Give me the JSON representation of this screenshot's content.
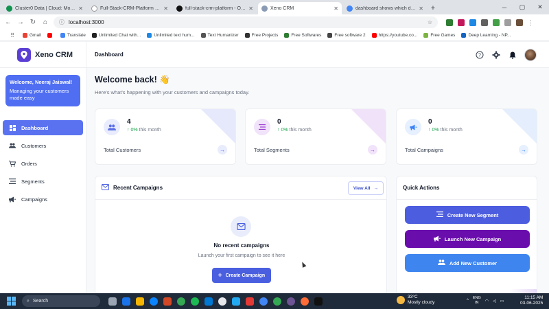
{
  "browser": {
    "tabs": [
      {
        "title": "Cluster0 Data | Cloud: MongoDB",
        "color": "#12924f",
        "active": false
      },
      {
        "title": "Full-Stack-CRM-Platform - We...",
        "color": "#ffffff",
        "active": false
      },
      {
        "title": "full-stack-crm-platform - Over...",
        "color": "#111111",
        "active": false
      },
      {
        "title": "Xeno CRM",
        "color": "#8a9bb3",
        "active": true
      },
      {
        "title": "dashboard shows which data a...",
        "color": "#4285f4",
        "active": false
      }
    ],
    "new_tab": "+",
    "url": "localhost:3000",
    "bookmarks": [
      {
        "label": "Gmail",
        "color": "#ea4335"
      },
      {
        "label": "",
        "color": "#ff0000"
      },
      {
        "label": "Translate",
        "color": "#4285f4"
      },
      {
        "label": "Unlimited Chat with...",
        "color": "#222222"
      },
      {
        "label": "Unlimited text hum...",
        "color": "#1e88e5"
      },
      {
        "label": "Text Humanizer",
        "color": "#555555"
      },
      {
        "label": "Free Projects",
        "color": "#333333"
      },
      {
        "label": "Free Softwares",
        "color": "#2e7d32"
      },
      {
        "label": "Free software 2",
        "color": "#444444"
      },
      {
        "label": "https://youtube.co...",
        "color": "#ff0000"
      },
      {
        "label": "Free Games",
        "color": "#7cb342"
      },
      {
        "label": "Deep Learning - NP...",
        "color": "#1565c0"
      }
    ]
  },
  "app": {
    "brand": "Xeno CRM",
    "welcome_card": {
      "title": "Welcome, Neeraj Jaiswal!",
      "subtitle": "Managing your customers made easy"
    },
    "menu": [
      {
        "label": "Dashboard",
        "icon": "grid-icon",
        "active": true
      },
      {
        "label": "Customers",
        "icon": "people-icon",
        "active": false
      },
      {
        "label": "Orders",
        "icon": "cart-icon",
        "active": false
      },
      {
        "label": "Segments",
        "icon": "list-icon",
        "active": false
      },
      {
        "label": "Campaigns",
        "icon": "megaphone-icon",
        "active": false
      }
    ],
    "page_title": "Dashboard",
    "greeting": "Welcome back! 👋",
    "greeting_sub": "Here's what's happening with your customers and campaigns today.",
    "stats": [
      {
        "value": "4",
        "trend": "0%",
        "trend_suffix": "this month",
        "label": "Total Customers",
        "accent": "#5b6ee6",
        "tint": "#e8ecfc",
        "corner": "#e6e9fb"
      },
      {
        "value": "0",
        "trend": "0%",
        "trend_suffix": "this month",
        "label": "Total Segments",
        "accent": "#9b3fd1",
        "tint": "#f1e3fa",
        "corner": "#f0e2f9"
      },
      {
        "value": "0",
        "trend": "0%",
        "trend_suffix": "this month",
        "label": "Total Campaigns",
        "accent": "#3b82f6",
        "tint": "#e6f0fe",
        "corner": "#e4eefc"
      }
    ],
    "recent_campaigns": {
      "title": "Recent Campaigns",
      "view_all": "View All",
      "empty_title": "No recent campaigns",
      "empty_sub": "Launch your first campaign to see it here",
      "create_button": "Create Campaign"
    },
    "quick_actions": {
      "title": "Quick Actions",
      "buttons": [
        {
          "label": "Create New Segment",
          "color": "#4c5ddf"
        },
        {
          "label": "Launch New Campaign",
          "color": "#6a0dad"
        },
        {
          "label": "Add New Customer",
          "color": "#3f85f0"
        }
      ]
    }
  },
  "taskbar": {
    "search": "Search",
    "weather_temp": "33°C",
    "weather_desc": "Mostly cloudy",
    "lang_top": "ENG",
    "lang_bottom": "IN",
    "time": "11:15 AM",
    "date": "03-06-2025"
  }
}
